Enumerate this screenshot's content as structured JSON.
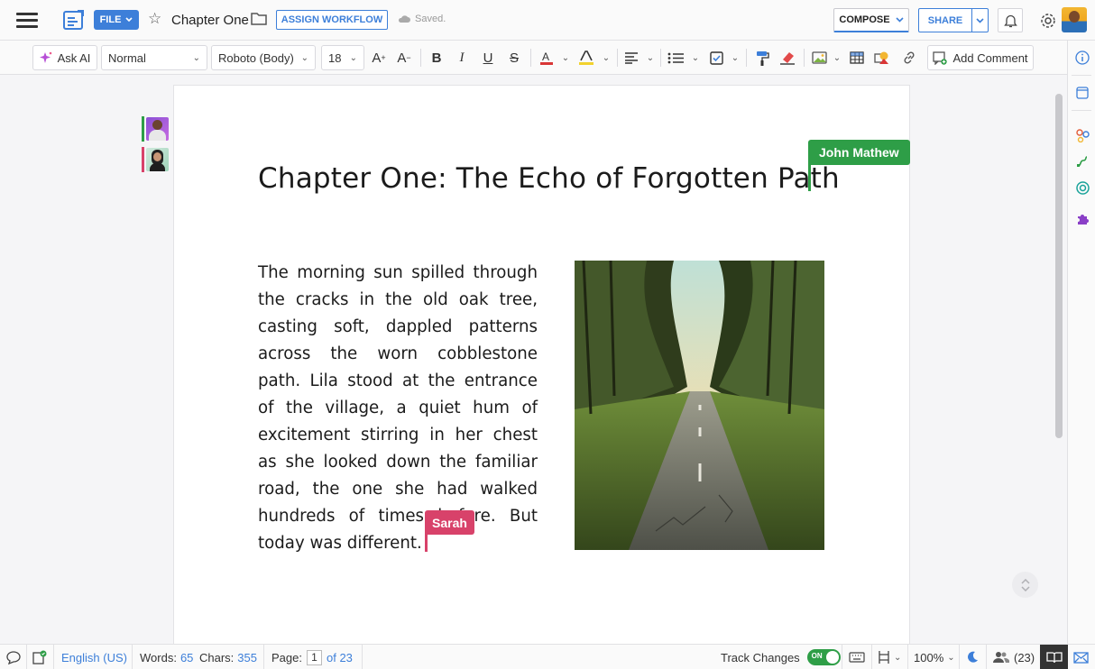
{
  "app": {
    "file_label": "FILE",
    "doc_title": "Chapter One",
    "assign_workflow_label": "ASSIGN WORKFLOW",
    "save_status": "Saved.",
    "compose_label": "COMPOSE",
    "share_label": "SHARE"
  },
  "toolbar": {
    "ask_ai_label": "Ask AI",
    "paragraph_style": "Normal",
    "font_family": "Roboto (Body)",
    "font_size": "18",
    "add_comment_label": "Add Comment"
  },
  "document": {
    "heading": "Chapter One: The Echo of Forgotten Path",
    "paragraph": "The morning sun spilled through the cracks in the old oak tree, casting soft, dappled patterns across the worn cobblestone path. Lila stood at the entrance of the village, a quiet hum of excitement stirring in her chest as she looked down the familiar road, the one she had walked hundreds of times before. But today was different.",
    "collaborators": [
      {
        "name": "John Mathew",
        "color": "#2e9e47"
      },
      {
        "name": "Sarah",
        "color": "#d8426a"
      }
    ]
  },
  "status": {
    "language": "English (US)",
    "words_label": "Words:",
    "words_value": "65",
    "chars_label": "Chars:",
    "chars_value": "355",
    "page_label": "Page:",
    "page_current": "1",
    "page_total": "of 23",
    "track_changes_label": "Track Changes",
    "track_changes_state": "ON",
    "zoom": "100%",
    "viewers": "(23)"
  },
  "colors": {
    "accent": "#3d7fd9",
    "john_cursor": "#2e9e47",
    "sarah_cursor": "#d8426a"
  }
}
